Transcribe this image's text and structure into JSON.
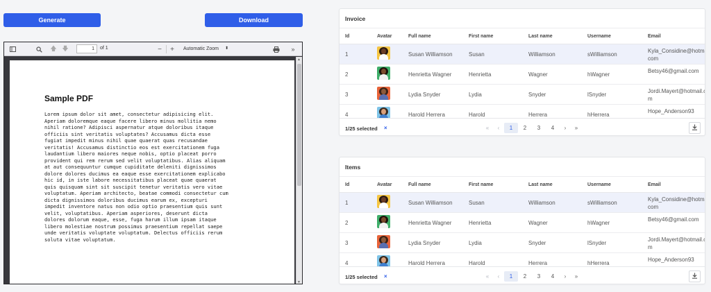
{
  "buttons": {
    "generate": "Generate",
    "download": "Download"
  },
  "viewer": {
    "page_current": "1",
    "page_of": "of 1",
    "zoom": "Automatic Zoom",
    "zoom_out": "−",
    "zoom_in": "+",
    "doc_title": "Sample PDF",
    "doc_lines": [
      "Lorem ipsum dolor sit amet, consectetur adipisicing elit.",
      "Aperiam doloremque eaque facere libero minus mollitia nemo",
      "nihil ratione? Adipisci aspernatur atque doloribus itaque",
      "officiis sint veritatis voluptates? Accusamus dicta esse",
      "fugiat impedit minus nihil quae quaerat quas recusandae",
      "veritatis! Accusamus distinctio eos est exercitationem fuga",
      "laudantium libero maiores neque nobis, optio placeat porro",
      "provident qui rem rerum sed velit voluptatibus. Alias aliquam",
      "at aut consequuntur cumque cupiditate deleniti dignissimos",
      "dolore dolores ducimus ea eaque esse exercitationem explicabo",
      "hic id, in iste labore necessitatibus placeat quae quaerat",
      "quis quisquam sint sit suscipit tenetur veritatis vero vitae",
      "voluptatum. Aperiam architecto, beatae commodi consectetur cum",
      "dicta dignissimos doloribus ducimus earum ex, excepturi",
      "impedit inventore natus non odio optio praesentium quis sunt",
      "velit, voluptatibus. Aperiam asperiores, deserunt dicta",
      "dolores dolorum eaque, esse, fuga harum illum ipsam itaque",
      "libero molestiae nostrum possimus praesentium repellat saepe",
      "unde veritatis voluptate voluptatum. Delectus officiis rerum",
      "soluta vitae voluptatum."
    ]
  },
  "columns": [
    "Id",
    "Avatar",
    "Full name",
    "First name",
    "Last name",
    "Username",
    "Email"
  ],
  "rows": [
    {
      "id": "1",
      "full": "Susan Williamson",
      "first": "Susan",
      "last": "Williamson",
      "user": "sWilliamson",
      "email": "Kyla_Considine@hotmail.com",
      "avatar_bg": "#f5c542",
      "skin": "#6b3e26",
      "hair": "#2b1a12",
      "shirt": "#ffffff"
    },
    {
      "id": "2",
      "full": "Henrietta Wagner",
      "first": "Henrietta",
      "last": "Wagner",
      "user": "hWagner",
      "email": "Betsy46@gmail.com",
      "avatar_bg": "#3fae6a",
      "skin": "#7a4a2c",
      "hair": "#1c110b",
      "shirt": "#f2f2f2"
    },
    {
      "id": "3",
      "full": "Lydia Snyder",
      "first": "Lydia",
      "last": "Snyder",
      "user": "lSnyder",
      "email": "Jordi.Mayert@hotmail.com",
      "avatar_bg": "#e8643a",
      "skin": "#8c5a3a",
      "hair": "#3a2216",
      "shirt": "#5a6fb0"
    },
    {
      "id": "4",
      "full": "Harold Herrera",
      "first": "Harold",
      "last": "Herrera",
      "user": "hHerrera",
      "email": "Hope_Anderson93",
      "avatar_bg": "#7fc4e8",
      "skin": "#d9a07a",
      "hair": "#3a2a20",
      "shirt": "#3f7fd0"
    }
  ],
  "grids": {
    "invoice": {
      "title": "Invoice",
      "selected": "1/25 selected",
      "clear": "×"
    },
    "items": {
      "title": "Items",
      "selected": "1/25 selected",
      "clear": "×"
    }
  },
  "pager": {
    "first": "«",
    "prev": "‹",
    "pages": [
      "1",
      "2",
      "3",
      "4"
    ],
    "next": "›",
    "last": "»",
    "active": "1"
  },
  "colors": {
    "primary": "#2f5ee8",
    "selected_row": "#eef1fb"
  },
  "icons": [
    "sidebar-toggle-icon",
    "search-icon",
    "arrow-up-icon",
    "arrow-down-icon",
    "print-icon",
    "tools-icon",
    "download-icon",
    "clear-icon"
  ]
}
